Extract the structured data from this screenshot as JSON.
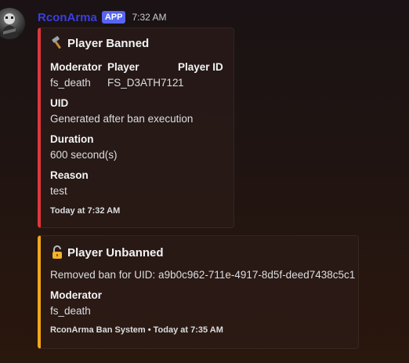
{
  "message": {
    "username": "RconArma",
    "badge": "APP",
    "timestamp": "7:32 AM"
  },
  "embed_ban": {
    "title": "Player Banned",
    "title_icon": "hammer-icon",
    "accent_color": "#e0373b",
    "fields": {
      "moderator_name": "Moderator",
      "moderator_value": "fs_death",
      "player_name": "Player",
      "player_value": "FS_D3ATH712",
      "player_id_name": "Player ID",
      "player_id_value": "1",
      "uid_name": "UID",
      "uid_value": "Generated after ban execution",
      "duration_name": "Duration",
      "duration_value": "600 second(s)",
      "reason_name": "Reason",
      "reason_value": "test"
    },
    "footer": "Today at 7:32 AM"
  },
  "embed_unban": {
    "title": "Player Unbanned",
    "title_icon": "unlocked-padlock-icon",
    "accent_color": "#f0a81a",
    "description": "Removed ban for UID: a9b0c962-711e-4917-8d5f-deed7438c5c1",
    "moderator_name": "Moderator",
    "moderator_value": "fs_death",
    "footer": "RconArma Ban System • Today at 7:35 AM"
  }
}
